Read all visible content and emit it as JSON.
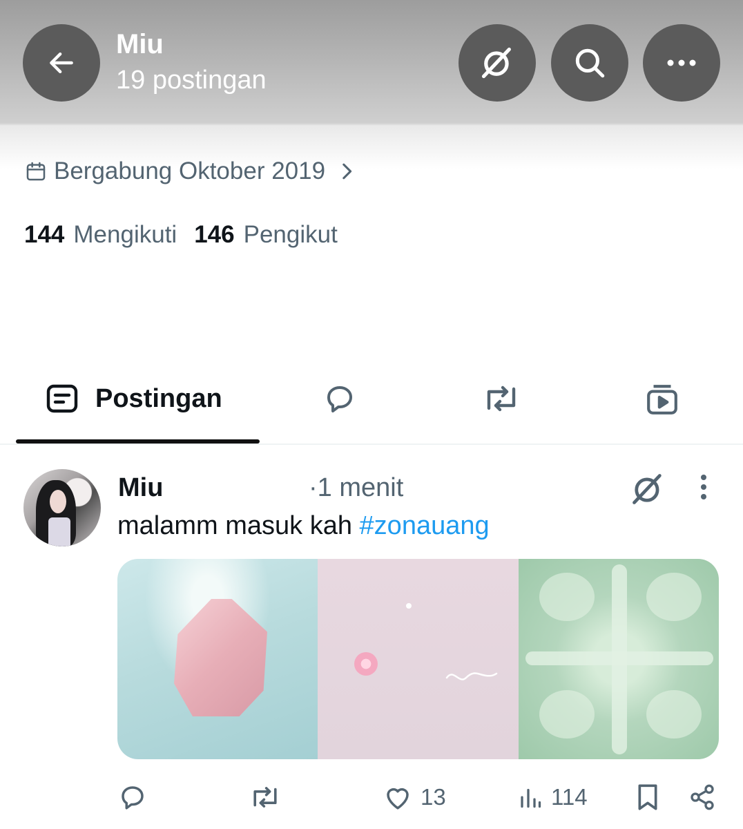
{
  "header": {
    "title": "Miu",
    "post_count": "19 postingan",
    "icons": [
      "arrow-left-icon",
      "grok-icon",
      "search-icon",
      "more-horizontal-icon"
    ]
  },
  "profile": {
    "joined": "Bergabung Oktober 2019",
    "following_count": "144",
    "following_label": "Mengikuti",
    "followers_count": "146",
    "followers_label": "Pengikut"
  },
  "tabs": {
    "active_label": "Postingan",
    "icons": [
      "posts-icon",
      "replies-icon",
      "reposts-icon",
      "media-icon"
    ]
  },
  "post": {
    "author": "Miu",
    "time": "·1 menit",
    "text": "malamm masuk kah ",
    "hashtag": "#zonauang",
    "likes": "13",
    "views": "114"
  },
  "colors": {
    "header_button": "#5b5b5b",
    "secondary_text": "#536471",
    "hashtag": "#1d9bf0",
    "primary_text": "#0f1419"
  }
}
